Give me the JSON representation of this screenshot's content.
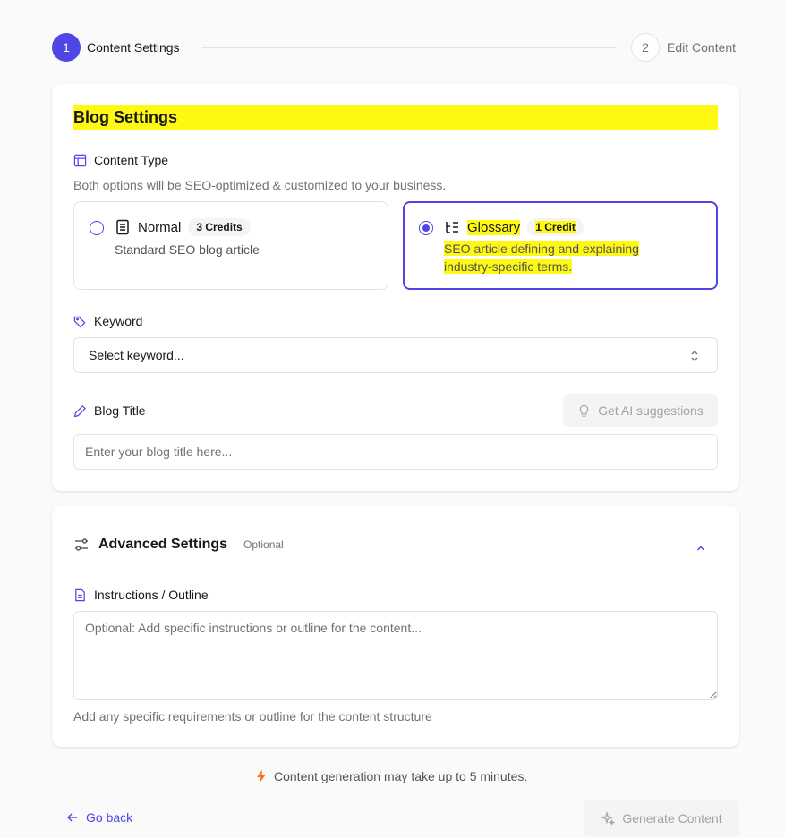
{
  "stepper": {
    "step1": {
      "number": "1",
      "label": "Content Settings"
    },
    "step2": {
      "number": "2",
      "label": "Edit Content"
    }
  },
  "blog_settings": {
    "heading": "Blog Settings",
    "content_type": {
      "label": "Content Type",
      "description": "Both options will be SEO-optimized & customized to your business.",
      "options": [
        {
          "name": "Normal",
          "credits": "3 Credits",
          "description": "Standard SEO blog article",
          "selected": false
        },
        {
          "name": "Glossary",
          "credits": "1 Credit",
          "description": "SEO article defining and explaining industry-specific terms.",
          "selected": true
        }
      ]
    },
    "keyword": {
      "label": "Keyword",
      "value": "Select keyword..."
    },
    "blog_title": {
      "label": "Blog Title",
      "ai_button": "Get AI suggestions",
      "placeholder": "Enter your blog title here..."
    }
  },
  "advanced_settings": {
    "title": "Advanced Settings",
    "optional_tag": "Optional",
    "instructions": {
      "label": "Instructions / Outline",
      "placeholder": "Optional: Add specific instructions or outline for the content...",
      "help": "Add any specific requirements or outline for the content structure"
    }
  },
  "footer": {
    "notice": "Content generation may take up to 5 minutes.",
    "back_label": "Go back",
    "generate_label": "Generate Content"
  },
  "colors": {
    "accent": "#4f46e5",
    "highlight": "#fff813",
    "notice_icon": "#f97316"
  }
}
